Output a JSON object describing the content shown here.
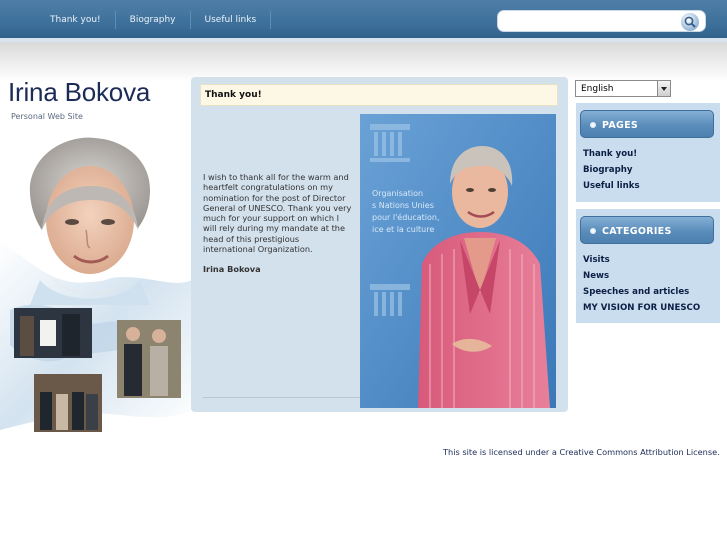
{
  "nav": {
    "items": [
      "Thank you!",
      "Biography",
      "Useful links"
    ]
  },
  "search": {
    "value": "",
    "placeholder": ""
  },
  "site": {
    "title": "Irina Bokova",
    "subtitle": "Personal Web Site"
  },
  "content": {
    "heading": "Thank you!",
    "body": "I wish to thank all for the warm and heartfelt congratulations on my nomination for the post of Director General of UNESCO. Thank you very much for your support on which I will rely during my mandate at the head of this prestigious international Organization.",
    "signature": "Irina Bokova"
  },
  "language": {
    "selected": "English"
  },
  "pages_box": {
    "title": "PAGES",
    "items": [
      "Thank you!",
      "Biography",
      "Useful links"
    ]
  },
  "categories_box": {
    "title": "CATEGORIES",
    "items": [
      "Visits",
      "News",
      "Speeches and articles",
      "MY VISION FOR UNESCO"
    ]
  },
  "footer": {
    "text": "This site is licensed under a Creative Commons Attribution License."
  },
  "colors": {
    "topbar": "#3c6f99",
    "accent": "#5b8dbb",
    "panel": "#d3e1ed",
    "title": "#1c2c57"
  }
}
